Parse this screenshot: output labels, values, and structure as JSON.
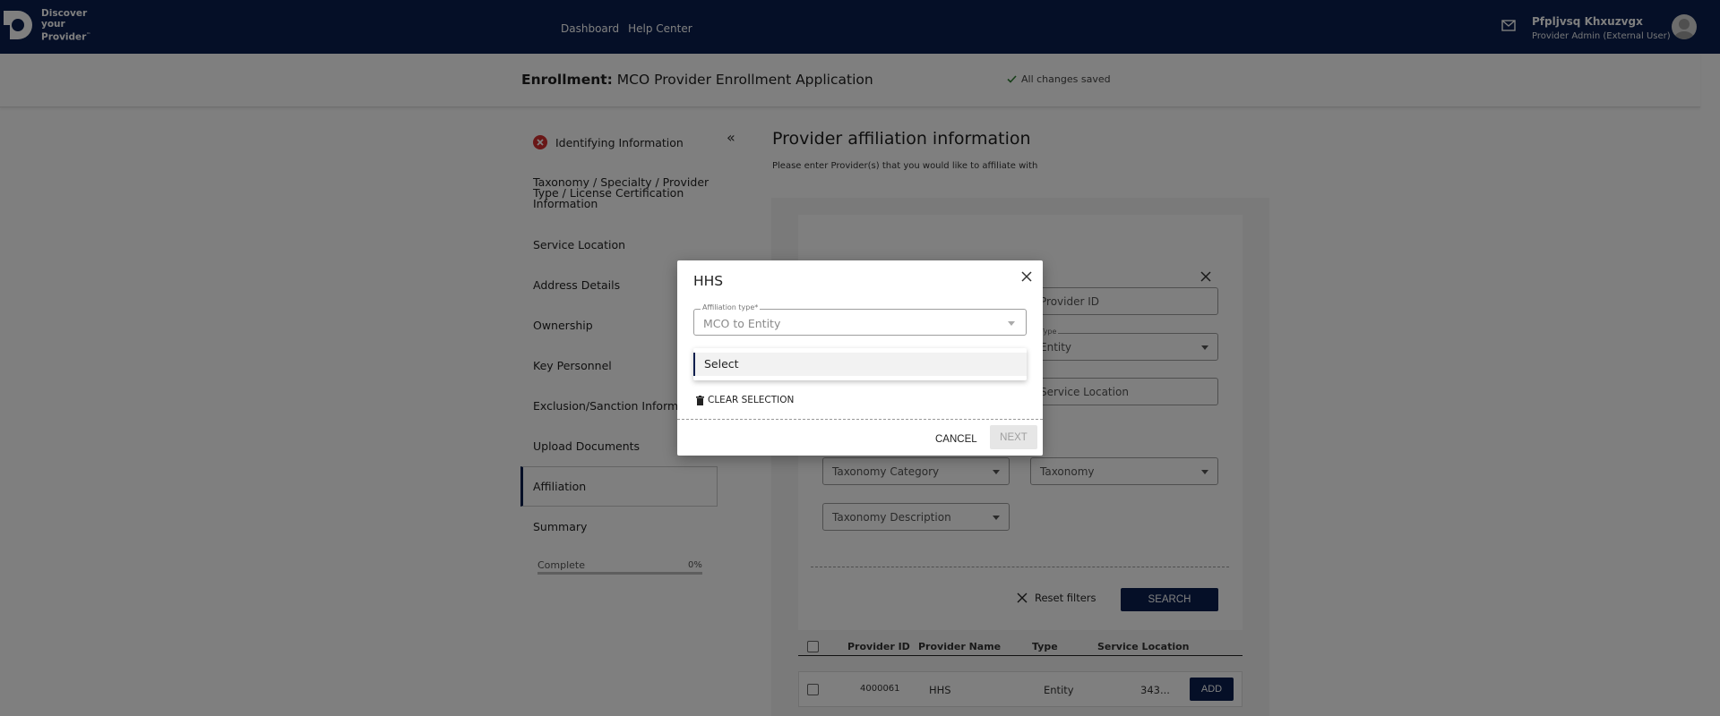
{
  "header": {
    "logo_lines": [
      "Discover",
      "your",
      "Provider"
    ],
    "logo_tm": "™",
    "nav": [
      "Dashboard",
      "Help Center"
    ],
    "user_name": "Pfpljvsq Khxuzvgx",
    "user_role": "Provider Admin (External User)"
  },
  "subheader": {
    "label": "Enrollment:",
    "title": "MCO Provider Enrollment Application",
    "saved": "All changes saved"
  },
  "sidebar": {
    "items": [
      {
        "label": "Identifying Information",
        "status": "error"
      },
      {
        "label": "Taxonomy / Specialty / Provider Type / License Certification Information"
      },
      {
        "label": "Service Location"
      },
      {
        "label": "Address Details"
      },
      {
        "label": "Ownership"
      },
      {
        "label": "Key Personnel"
      },
      {
        "label": "Exclusion/Sanction Information"
      },
      {
        "label": "Upload Documents"
      },
      {
        "label": "Affiliation",
        "active": true
      },
      {
        "label": "Summary"
      }
    ],
    "progress_label": "Complete",
    "progress_pct": "0%",
    "progress_value": 0
  },
  "main": {
    "title": "Provider affiliation information",
    "subtitle": "Please enter Provider(s) that you would like to affiliate with",
    "filters": {
      "provider_id_placeholder": "Provider ID",
      "type_label": "Type",
      "type_value": "Entity",
      "service_location_placeholder": "Service Location",
      "taxonomy_category": "Taxonomy Category",
      "taxonomy": "Taxonomy",
      "taxonomy_description": "Taxonomy Description",
      "reset_label": "Reset filters",
      "search_label": "SEARCH"
    },
    "table": {
      "columns": [
        "Provider ID",
        "Provider Name",
        "Type",
        "Service Location"
      ],
      "rows": [
        {
          "id": "4000061",
          "name": "HHS",
          "type": "Entity",
          "location": "343...",
          "action": "ADD"
        }
      ]
    }
  },
  "modal": {
    "title": "HHS",
    "field_label": "Affiliation type*",
    "field_value": "MCO to Entity",
    "option": "Select",
    "clear_label": "CLEAR SELECTION",
    "cancel_label": "CANCEL",
    "next_label": "NEXT"
  },
  "colors": {
    "navy": "#0a1f4e",
    "error": "#d32f2f"
  }
}
